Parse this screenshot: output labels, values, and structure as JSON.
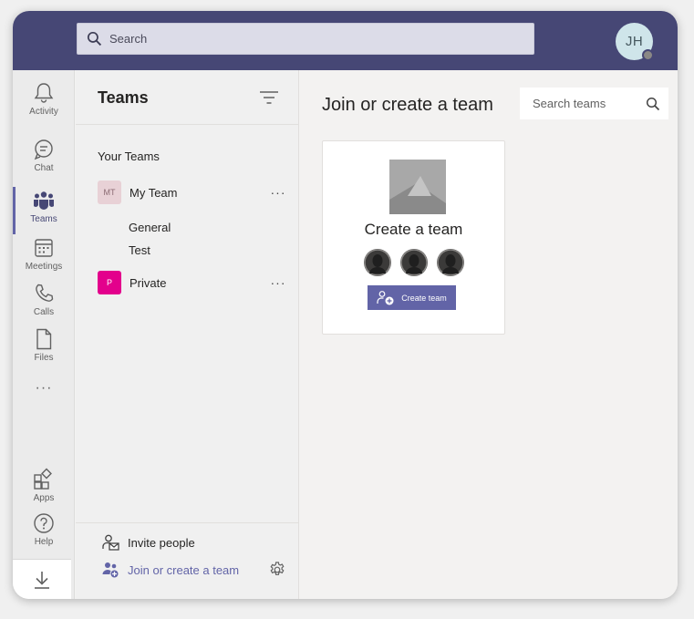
{
  "header": {
    "search_placeholder": "Search",
    "user_initials": "JH"
  },
  "rail": {
    "items": [
      {
        "label": "Activity",
        "icon": "bell-icon"
      },
      {
        "label": "Chat",
        "icon": "chat-icon"
      },
      {
        "label": "Teams",
        "icon": "teams-icon",
        "active": true
      },
      {
        "label": "Meetings",
        "icon": "calendar-icon"
      },
      {
        "label": "Calls",
        "icon": "phone-icon"
      },
      {
        "label": "Files",
        "icon": "file-icon"
      }
    ],
    "more": "···",
    "apps_label": "Apps",
    "help_label": "Help"
  },
  "teams_panel": {
    "title": "Teams",
    "section_label": "Your Teams",
    "teams": [
      {
        "initials": "MT",
        "name": "My Team",
        "more": "···",
        "badge_bg": "#e8d1d6",
        "badge_fg": "#8a6a72",
        "channels": [
          "General",
          "Test"
        ]
      },
      {
        "initials": "P",
        "name": "Private",
        "more": "···",
        "badge_bg": "#e3008c",
        "badge_fg": "#ffffff",
        "channels": []
      }
    ],
    "footer": {
      "invite_label": "Invite people",
      "join_label": "Join or create a team"
    }
  },
  "main": {
    "title": "Join or create a team",
    "search_placeholder": "Search teams",
    "card": {
      "title": "Create a team",
      "button_label": "Create team"
    }
  },
  "colors": {
    "brand": "#464775",
    "accent": "#6264a7"
  }
}
